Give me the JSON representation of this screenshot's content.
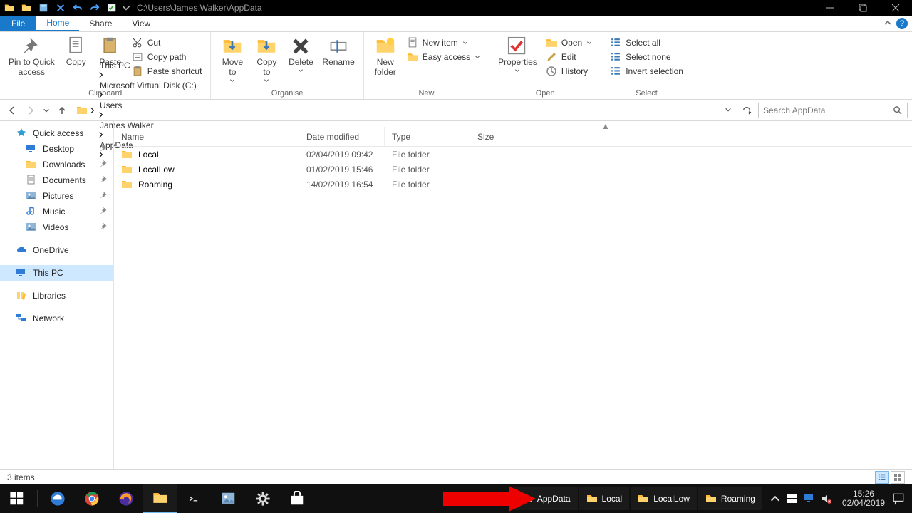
{
  "title_path": "C:\\Users\\James Walker\\AppData",
  "ribbon_tabs": {
    "file": "File",
    "home": "Home",
    "share": "Share",
    "view": "View"
  },
  "ribbon": {
    "clipboard": {
      "pin": "Pin to Quick\naccess",
      "copy": "Copy",
      "paste": "Paste",
      "cut": "Cut",
      "copypath": "Copy path",
      "pasteshortcut": "Paste shortcut",
      "label": "Clipboard"
    },
    "organise": {
      "moveto": "Move\nto",
      "copyto": "Copy\nto",
      "delete": "Delete",
      "rename": "Rename",
      "label": "Organise"
    },
    "new": {
      "newfolder": "New\nfolder",
      "newitem": "New item",
      "easyaccess": "Easy access",
      "label": "New"
    },
    "open": {
      "properties": "Properties",
      "open": "Open",
      "edit": "Edit",
      "history": "History",
      "label": "Open"
    },
    "select": {
      "selectall": "Select all",
      "selectnone": "Select none",
      "invert": "Invert selection",
      "label": "Select"
    }
  },
  "breadcrumbs": [
    "This PC",
    "Microsoft Virtual Disk (C:)",
    "Users",
    "James Walker",
    "AppData"
  ],
  "search_placeholder": "Search AppData",
  "nav": {
    "quick": "Quick access",
    "pinned": [
      "Desktop",
      "Downloads",
      "Documents",
      "Pictures",
      "Music",
      "Videos"
    ],
    "onedrive": "OneDrive",
    "thispc": "This PC",
    "libraries": "Libraries",
    "network": "Network"
  },
  "columns": {
    "name": "Name",
    "date": "Date modified",
    "type": "Type",
    "size": "Size"
  },
  "rows": [
    {
      "name": "Local",
      "date": "02/04/2019 09:42",
      "type": "File folder",
      "size": ""
    },
    {
      "name": "LocalLow",
      "date": "01/02/2019 15:46",
      "type": "File folder",
      "size": ""
    },
    {
      "name": "Roaming",
      "date": "14/02/2019 16:54",
      "type": "File folder",
      "size": ""
    }
  ],
  "status": "3 items",
  "taskbar_windows": [
    "AppData",
    "Local",
    "LocalLow",
    "Roaming"
  ],
  "clock": {
    "time": "15:26",
    "date": "02/04/2019"
  }
}
